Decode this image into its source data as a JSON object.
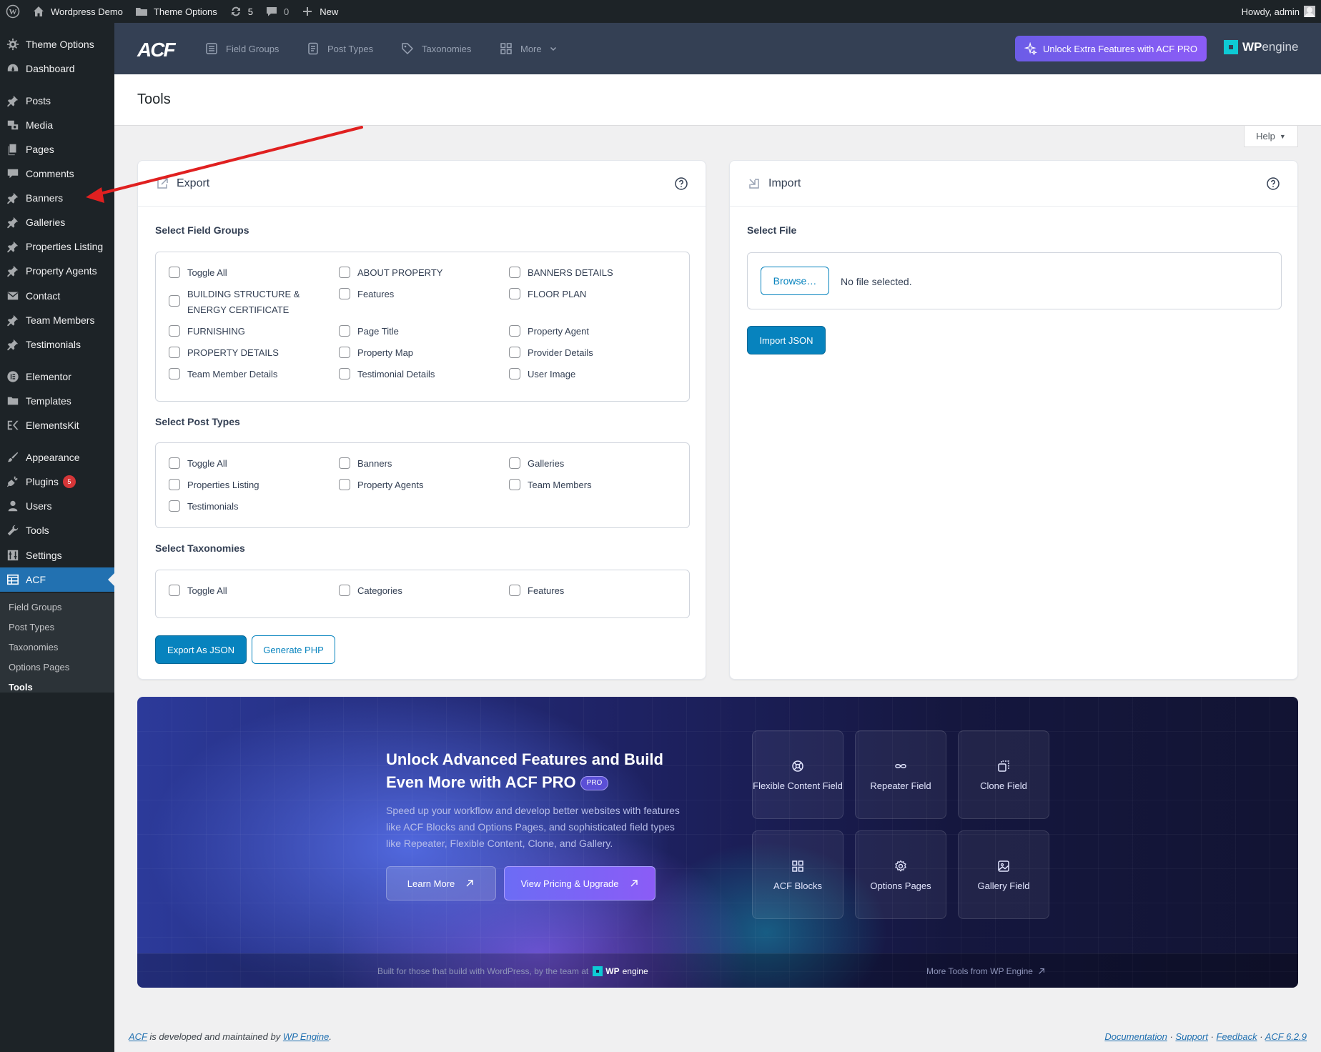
{
  "adminbar": {
    "site_name": "Wordpress Demo",
    "theme_options": "Theme Options",
    "updates_count": "5",
    "comments_count": "0",
    "new_label": "New",
    "howdy": "Howdy, admin"
  },
  "sidebar": {
    "items": [
      {
        "label": "Theme Options",
        "icon": "gear-icon"
      },
      {
        "label": "Dashboard",
        "icon": "dashboard-icon"
      },
      {
        "label": "Posts",
        "icon": "pin-icon"
      },
      {
        "label": "Media",
        "icon": "media-icon"
      },
      {
        "label": "Pages",
        "icon": "pages-icon"
      },
      {
        "label": "Comments",
        "icon": "comment-icon"
      },
      {
        "label": "Banners",
        "icon": "pin-icon"
      },
      {
        "label": "Galleries",
        "icon": "pin-icon"
      },
      {
        "label": "Properties Listing",
        "icon": "pin-icon"
      },
      {
        "label": "Property Agents",
        "icon": "pin-icon"
      },
      {
        "label": "Contact",
        "icon": "mail-icon"
      },
      {
        "label": "Team Members",
        "icon": "pin-icon"
      },
      {
        "label": "Testimonials",
        "icon": "pin-icon"
      },
      {
        "label": "Elementor",
        "icon": "elementor-icon"
      },
      {
        "label": "Templates",
        "icon": "folder-icon"
      },
      {
        "label": "ElementsKit",
        "icon": "elementskit-icon"
      },
      {
        "label": "Appearance",
        "icon": "brush-icon"
      },
      {
        "label": "Plugins",
        "icon": "plug-icon",
        "badge": "5"
      },
      {
        "label": "Users",
        "icon": "user-icon"
      },
      {
        "label": "Tools",
        "icon": "wrench-icon"
      },
      {
        "label": "Settings",
        "icon": "settings-icon"
      },
      {
        "label": "ACF",
        "icon": "acf-icon"
      }
    ],
    "submenu": [
      "Field Groups",
      "Post Types",
      "Taxonomies",
      "Options Pages",
      "Tools"
    ]
  },
  "acf_header": {
    "logo": "ACF",
    "nav": [
      "Field Groups",
      "Post Types",
      "Taxonomies",
      "More"
    ],
    "pro_button": "Unlock Extra Features with ACF PRO",
    "wpengine_bold": "WP",
    "wpengine_light": "engine"
  },
  "page": {
    "title": "Tools",
    "help": "Help"
  },
  "export": {
    "title": "Export",
    "field_groups_label": "Select Field Groups",
    "field_groups": [
      "Toggle All",
      "ABOUT PROPERTY",
      "BANNERS DETAILS",
      "BUILDING STRUCTURE & ENERGY CERTIFICATE",
      "Features",
      "FLOOR PLAN",
      "FURNISHING",
      "Page Title",
      "Property Agent",
      "PROPERTY DETAILS",
      "Property Map",
      "Provider Details",
      "Team Member Details",
      "Testimonial Details",
      "User Image"
    ],
    "post_types_label": "Select Post Types",
    "post_types": [
      "Toggle All",
      "Banners",
      "Galleries",
      "Properties Listing",
      "Property Agents",
      "Team Members",
      "Testimonials"
    ],
    "taxonomies_label": "Select Taxonomies",
    "taxonomies": [
      "Toggle All",
      "Categories",
      "Features"
    ],
    "export_json": "Export As JSON",
    "generate_php": "Generate PHP"
  },
  "import": {
    "title": "Import",
    "select_file_label": "Select File",
    "browse": "Browse…",
    "no_file": "No file selected.",
    "import_json": "Import JSON"
  },
  "promo": {
    "title_line1": "Unlock Advanced Features and Build",
    "title_line2": "Even More with ACF PRO",
    "pro_badge": "PRO",
    "text": "Speed up your workflow and develop better websites with features like ACF Blocks and Options Pages, and sophisticated field types like Repeater, Flexible Content, Clone, and Gallery.",
    "learn_more": "Learn More",
    "upgrade": "View Pricing & Upgrade",
    "features": [
      "Flexible Content Field",
      "Repeater Field",
      "Clone Field",
      "ACF Blocks",
      "Options Pages",
      "Gallery Field"
    ],
    "footer_left": "Built for those that build with WordPress, by the team at",
    "footer_right": "More Tools from WP Engine"
  },
  "footer": {
    "acf": "ACF",
    "developed": " is developed and maintained by ",
    "wpengine": "WP Engine",
    "period": ".",
    "links": [
      "Documentation",
      "Support",
      "Feedback",
      "ACF 6.2.9"
    ],
    "sep": " · "
  },
  "colors": {
    "admin_dark": "#1d2327",
    "wp_blue": "#2271b1",
    "acf_header": "#344054",
    "acf_primary": "#0783be",
    "pro_purple": "#8b5cf6",
    "annotation_red": "#e02020"
  }
}
